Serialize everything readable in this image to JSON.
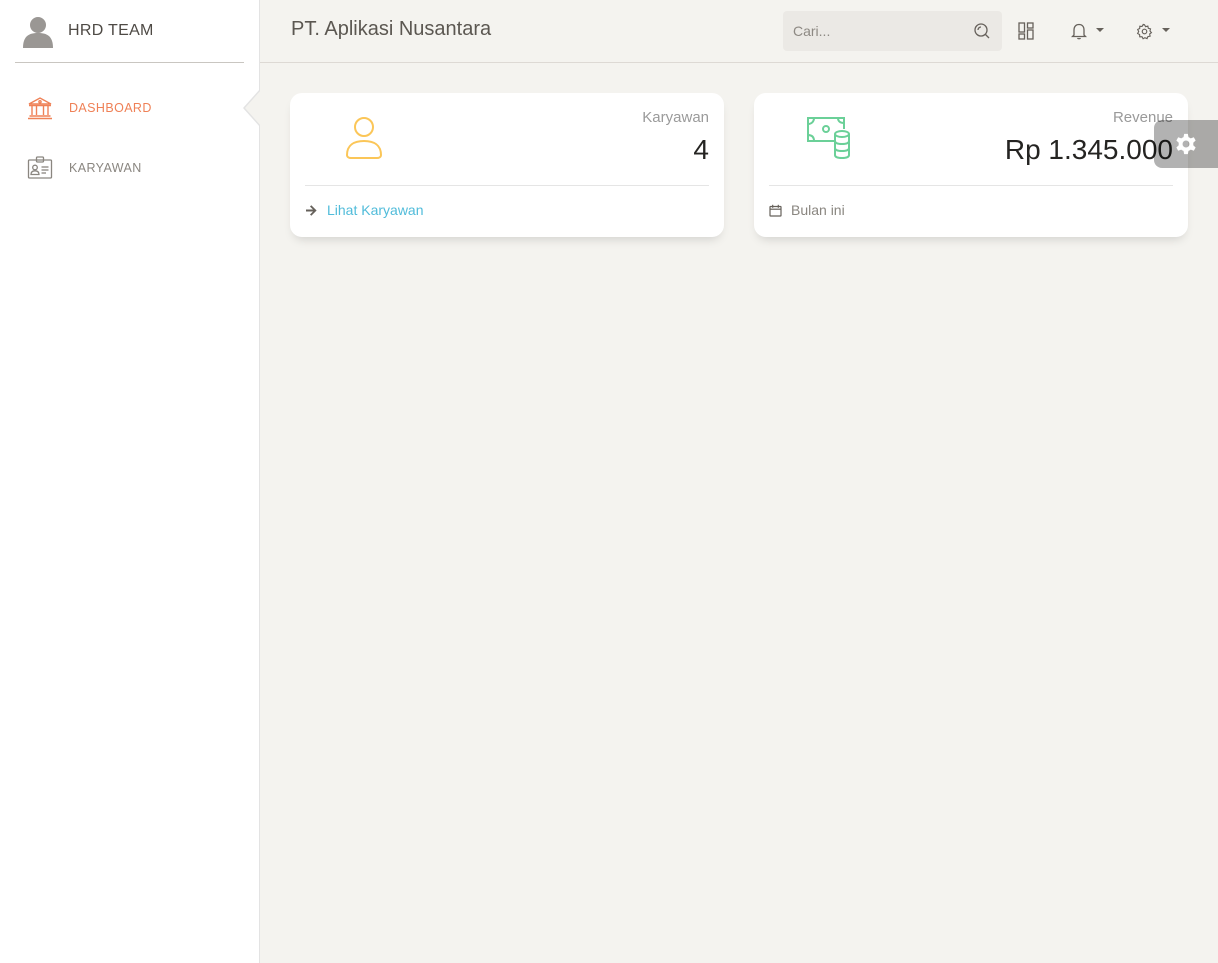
{
  "sidebar": {
    "brand": "HRD TEAM",
    "items": [
      {
        "label": "DASHBOARD",
        "icon": "bank-icon",
        "active": true
      },
      {
        "label": "KARYAWAN",
        "icon": "id-badge-icon",
        "active": false
      }
    ]
  },
  "navbar": {
    "title": "PT. Aplikasi Nusantara",
    "search_placeholder": "Cari..."
  },
  "cards": [
    {
      "category": "Karyawan",
      "value": "4",
      "footer": "Lihat Karyawan",
      "icon": "user-icon",
      "footer_icon": "arrow-right-icon"
    },
    {
      "category": "Revenue",
      "value": "Rp 1.345.000",
      "footer": "Bulan ini",
      "icon": "money-coins-icon",
      "footer_icon": "calendar-icon"
    }
  ],
  "colors": {
    "accent": "#ef8157",
    "teal": "#51bcda",
    "user_icon": "#fbc658",
    "money_icon": "#6bd098",
    "background": "#f4f3ef"
  }
}
